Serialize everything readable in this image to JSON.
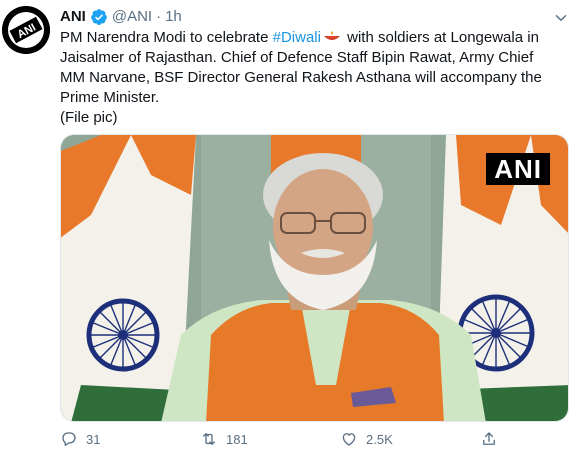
{
  "author": {
    "name": "ANI",
    "handle": "@ANI",
    "separator": "·",
    "time": "1h",
    "avatar_text": "ANI"
  },
  "tweet": {
    "text_before_hashtag": "PM Narendra Modi to celebrate ",
    "hashtag": "#Diwali",
    "text_after_hashtag": " with soldiers at Longewala in Jaisalmer of Rajasthan. Chief of Defence Staff Bipin Rawat, Army Chief MM Narvane, BSF Director General Rakesh Asthana will accompany the Prime Minister.",
    "note": "(File pic)"
  },
  "media": {
    "watermark": "ANI",
    "background_color": "#7f9988",
    "flag_colors": {
      "saffron": "#e8782a",
      "white": "#f3f1ea",
      "green": "#2f6e3b",
      "chakra": "#1d2f7a"
    },
    "vest_color": "#e67a28"
  },
  "actions": {
    "reply_count": "31",
    "retweet_count": "181",
    "like_count": "2.5K",
    "reply_icon": "reply-icon",
    "retweet_icon": "retweet-icon",
    "like_icon": "heart-icon",
    "share_icon": "share-icon"
  },
  "colors": {
    "link": "#1b95e0",
    "verified": "#1da1f2",
    "secondary_text": "#5b7083"
  }
}
